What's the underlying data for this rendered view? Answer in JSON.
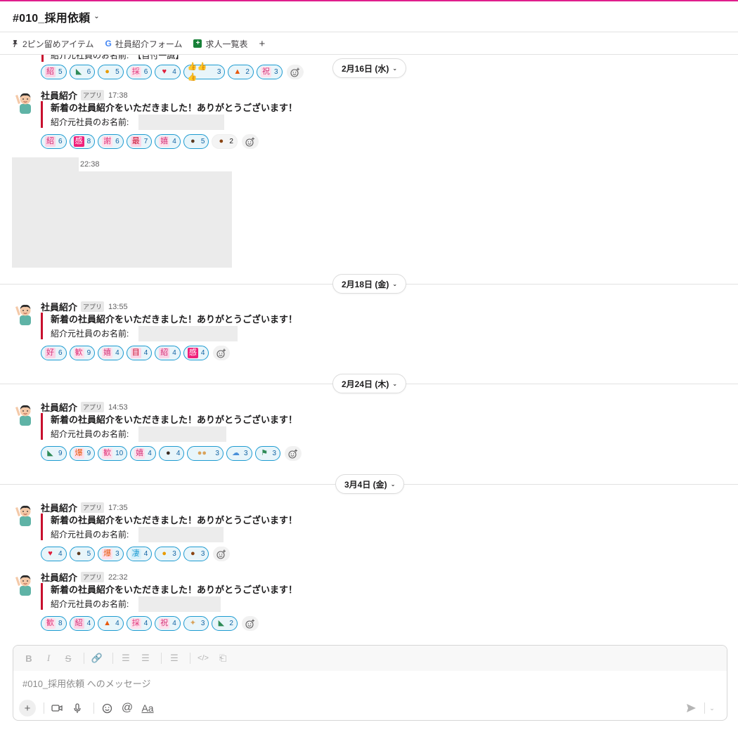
{
  "header": {
    "channel": "#010_採用依頼"
  },
  "bookmarks": [
    {
      "label": "2ピン留めアイテム",
      "icon": "pin-icon"
    },
    {
      "label": "社員紹介フォーム",
      "icon": "google-icon"
    },
    {
      "label": "求人一覧表",
      "icon": "sheets-icon"
    }
  ],
  "partial": {
    "text": "紹介元社員のお名前:　【自付一誠】"
  },
  "dates": [
    "2月16日 (水)",
    "2月18日 (金)",
    "2月24日 (木)",
    "3月4日 (金)"
  ],
  "messages": [
    {
      "sender": "社員紹介",
      "badge": "アプリ",
      "time": "17:38",
      "title": "新着の社員紹介をいただきました！ありがとうございます！",
      "field": "紹介元社員のお名前:",
      "reactions": [
        {
          "count": "6",
          "emoji": "stamp-pink-icon"
        },
        {
          "count": "8",
          "emoji": "stamp-magenta-icon"
        },
        {
          "count": "6",
          "emoji": "stamp-pink-icon"
        },
        {
          "count": "7",
          "emoji": "stamp-red-icon"
        },
        {
          "count": "4",
          "emoji": "stamp-pink-icon"
        },
        {
          "count": "5",
          "emoji": "person-icon"
        },
        {
          "count": "2",
          "emoji": "person-icon"
        }
      ]
    },
    {
      "time": "22:38"
    },
    {
      "sender": "社員紹介",
      "badge": "アプリ",
      "time": "13:55",
      "title": "新着の社員紹介をいただきました！ありがとうございます！",
      "field": "紹介元社員のお名前:",
      "reactions": [
        {
          "count": "6"
        },
        {
          "count": "9"
        },
        {
          "count": "4"
        },
        {
          "count": "4"
        },
        {
          "count": "4"
        },
        {
          "count": "4"
        }
      ]
    },
    {
      "sender": "社員紹介",
      "badge": "アプリ",
      "time": "14:53",
      "title": "新着の社員紹介をいただきました！ありがとうございます！",
      "field": "紹介元社員のお名前:",
      "reactions": [
        {
          "count": "9"
        },
        {
          "count": "9"
        },
        {
          "count": "10"
        },
        {
          "count": "4"
        },
        {
          "count": "4"
        },
        {
          "count": "3"
        },
        {
          "count": "3"
        },
        {
          "count": "3"
        }
      ]
    },
    {
      "sender": "社員紹介",
      "badge": "アプリ",
      "time": "17:35",
      "title": "新着の社員紹介をいただきました！ありがとうございます！",
      "field": "紹介元社員のお名前:",
      "reactions": [
        {
          "count": "4"
        },
        {
          "count": "5"
        },
        {
          "count": "3"
        },
        {
          "count": "4"
        },
        {
          "count": "3"
        },
        {
          "count": "3"
        }
      ]
    },
    {
      "sender": "社員紹介",
      "badge": "アプリ",
      "time": "22:32",
      "title": "新着の社員紹介をいただきました！ありがとうございます！",
      "field": "紹介元社員のお名前:",
      "reactions": [
        {
          "count": "8"
        },
        {
          "count": "4"
        },
        {
          "count": "4"
        },
        {
          "count": "4"
        },
        {
          "count": "4"
        },
        {
          "count": "3"
        },
        {
          "count": "2"
        }
      ]
    }
  ],
  "top_reactions": [
    "5",
    "6",
    "5",
    "6",
    "4",
    "3",
    "2",
    "3"
  ],
  "composer": {
    "placeholder": "#010_採用依頼 へのメッセージ",
    "aa": "Aa"
  }
}
